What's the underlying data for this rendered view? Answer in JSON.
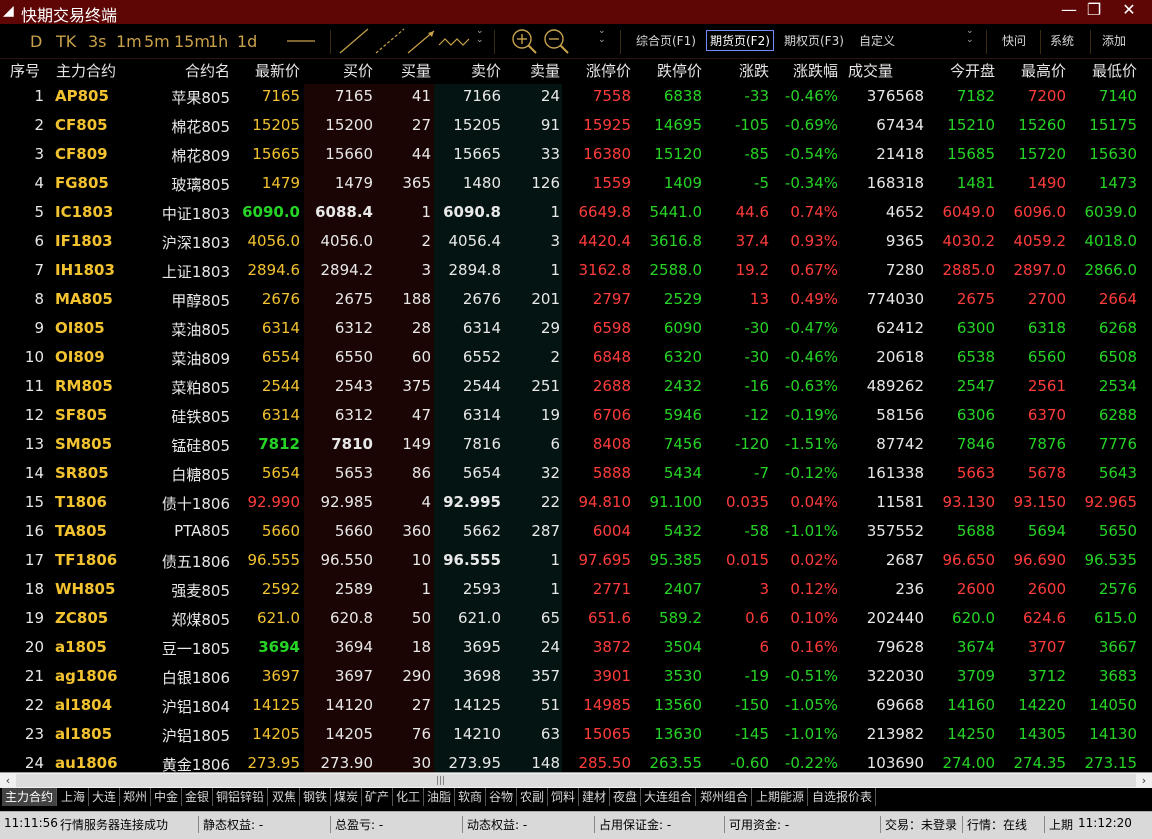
{
  "window": {
    "title": "快期交易终端",
    "minimize_glyph": "—",
    "maximize_glyph": "❐",
    "close_glyph": "✕"
  },
  "toolbar": {
    "timeframes": [
      "D",
      "TK",
      "3s",
      "1m",
      "5m",
      "15m",
      "1h",
      "1d"
    ],
    "buttons": [
      "综合页(F1)",
      "期货页(F2)",
      "期权页(F3)",
      "自定义"
    ],
    "active_button": "期货页(F2)",
    "right_buttons": [
      "快问",
      "系统",
      "添加"
    ]
  },
  "columns": [
    "序号",
    "主力合约",
    "合约名",
    "最新价",
    "买价",
    "买量",
    "卖价",
    "卖量",
    "涨停价",
    "跌停价",
    "涨跌",
    "涨跌幅",
    "成交量",
    "今开盘",
    "最高价",
    "最低价"
  ],
  "rows": [
    [
      "1",
      "AP805",
      "苹果805",
      "7165",
      "7165",
      "41",
      "7166",
      "24",
      "7558",
      "6838",
      "-33",
      "-0.46%",
      "376568",
      "7182",
      "7200",
      "7140"
    ],
    [
      "2",
      "CF805",
      "棉花805",
      "15205",
      "15200",
      "27",
      "15205",
      "91",
      "15925",
      "14695",
      "-105",
      "-0.69%",
      "67434",
      "15210",
      "15260",
      "15175"
    ],
    [
      "3",
      "CF809",
      "棉花809",
      "15665",
      "15660",
      "44",
      "15665",
      "33",
      "16380",
      "15120",
      "-85",
      "-0.54%",
      "21418",
      "15685",
      "15720",
      "15630"
    ],
    [
      "4",
      "FG805",
      "玻璃805",
      "1479",
      "1479",
      "365",
      "1480",
      "126",
      "1559",
      "1409",
      "-5",
      "-0.34%",
      "168318",
      "1481",
      "1490",
      "1473"
    ],
    [
      "5",
      "IC1803",
      "中证1803",
      "6090.0",
      "6088.4",
      "1",
      "6090.8",
      "1",
      "6649.8",
      "5441.0",
      "44.6",
      "0.74%",
      "4652",
      "6049.0",
      "6096.0",
      "6039.0"
    ],
    [
      "6",
      "IF1803",
      "沪深1803",
      "4056.0",
      "4056.0",
      "2",
      "4056.4",
      "3",
      "4420.4",
      "3616.8",
      "37.4",
      "0.93%",
      "9365",
      "4030.2",
      "4059.2",
      "4018.0"
    ],
    [
      "7",
      "IH1803",
      "上证1803",
      "2894.6",
      "2894.2",
      "3",
      "2894.8",
      "1",
      "3162.8",
      "2588.0",
      "19.2",
      "0.67%",
      "7280",
      "2885.0",
      "2897.0",
      "2866.0"
    ],
    [
      "8",
      "MA805",
      "甲醇805",
      "2676",
      "2675",
      "188",
      "2676",
      "201",
      "2797",
      "2529",
      "13",
      "0.49%",
      "774030",
      "2675",
      "2700",
      "2664"
    ],
    [
      "9",
      "OI805",
      "菜油805",
      "6314",
      "6312",
      "28",
      "6314",
      "29",
      "6598",
      "6090",
      "-30",
      "-0.47%",
      "62412",
      "6300",
      "6318",
      "6268"
    ],
    [
      "10",
      "OI809",
      "菜油809",
      "6554",
      "6550",
      "60",
      "6552",
      "2",
      "6848",
      "6320",
      "-30",
      "-0.46%",
      "20618",
      "6538",
      "6560",
      "6508"
    ],
    [
      "11",
      "RM805",
      "菜粕805",
      "2544",
      "2543",
      "375",
      "2544",
      "251",
      "2688",
      "2432",
      "-16",
      "-0.63%",
      "489262",
      "2547",
      "2561",
      "2534"
    ],
    [
      "12",
      "SF805",
      "硅铁805",
      "6314",
      "6312",
      "47",
      "6314",
      "19",
      "6706",
      "5946",
      "-12",
      "-0.19%",
      "58156",
      "6306",
      "6370",
      "6288"
    ],
    [
      "13",
      "SM805",
      "锰硅805",
      "7812",
      "7810",
      "149",
      "7816",
      "6",
      "8408",
      "7456",
      "-120",
      "-1.51%",
      "87742",
      "7846",
      "7876",
      "7776"
    ],
    [
      "14",
      "SR805",
      "白糖805",
      "5654",
      "5653",
      "86",
      "5654",
      "32",
      "5888",
      "5434",
      "-7",
      "-0.12%",
      "161338",
      "5663",
      "5678",
      "5643"
    ],
    [
      "15",
      "T1806",
      "债十1806",
      "92.990",
      "92.985",
      "4",
      "92.995",
      "22",
      "94.810",
      "91.100",
      "0.035",
      "0.04%",
      "11581",
      "93.130",
      "93.150",
      "92.965"
    ],
    [
      "16",
      "TA805",
      "PTA805",
      "5660",
      "5660",
      "360",
      "5662",
      "287",
      "6004",
      "5432",
      "-58",
      "-1.01%",
      "357552",
      "5688",
      "5694",
      "5650"
    ],
    [
      "17",
      "TF1806",
      "债五1806",
      "96.555",
      "96.550",
      "10",
      "96.555",
      "1",
      "97.695",
      "95.385",
      "0.015",
      "0.02%",
      "2687",
      "96.650",
      "96.690",
      "96.535"
    ],
    [
      "18",
      "WH805",
      "强麦805",
      "2592",
      "2589",
      "1",
      "2593",
      "1",
      "2771",
      "2407",
      "3",
      "0.12%",
      "236",
      "2600",
      "2600",
      "2576"
    ],
    [
      "19",
      "ZC805",
      "郑煤805",
      "621.0",
      "620.8",
      "50",
      "621.0",
      "65",
      "651.6",
      "589.2",
      "0.6",
      "0.10%",
      "202440",
      "620.0",
      "624.6",
      "615.0"
    ],
    [
      "20",
      "a1805",
      "豆一1805",
      "3694",
      "3694",
      "18",
      "3695",
      "24",
      "3872",
      "3504",
      "6",
      "0.16%",
      "79628",
      "3674",
      "3707",
      "3667"
    ],
    [
      "21",
      "ag1806",
      "白银1806",
      "3697",
      "3697",
      "290",
      "3698",
      "357",
      "3901",
      "3530",
      "-19",
      "-0.51%",
      "322030",
      "3709",
      "3712",
      "3683"
    ],
    [
      "22",
      "al1804",
      "沪铝1804",
      "14125",
      "14120",
      "27",
      "14125",
      "51",
      "14985",
      "13560",
      "-150",
      "-1.05%",
      "69668",
      "14160",
      "14220",
      "14050"
    ],
    [
      "23",
      "al1805",
      "沪铝1805",
      "14205",
      "14205",
      "76",
      "14210",
      "63",
      "15065",
      "13630",
      "-145",
      "-1.01%",
      "213982",
      "14250",
      "14305",
      "14130"
    ],
    [
      "24",
      "au1806",
      "黄金1806",
      "273.95",
      "273.90",
      "30",
      "273.95",
      "148",
      "285.50",
      "263.55",
      "-0.60",
      "-0.22%",
      "103690",
      "274.00",
      "274.35",
      "273.15"
    ]
  ],
  "tabs": [
    "主力合约",
    "上海",
    "大连",
    "郑州",
    "中金",
    "金银",
    "铜铝锌铅",
    "双焦",
    "钢铁",
    "煤炭",
    "矿产",
    "化工",
    "油脂",
    "软商",
    "谷物",
    "农副",
    "饲料",
    "建材",
    "夜盘",
    "大连组合",
    "郑州组合",
    "上期能源",
    "自选报价表"
  ],
  "active_tab": "主力合约",
  "status": {
    "time_left": "11:11:56",
    "message": "行情服务器连接成功",
    "static_equity": "静态权益: -",
    "total_pnl": "总盈亏: -",
    "dynamic_equity": "动态权益: -",
    "margin": "占用保证金: -",
    "available": "可用资金: -",
    "trade": "交易：未登录",
    "quote": "行情：在线",
    "market": "上期",
    "time_right": "11:12:20"
  },
  "colors": {
    "up": "#ff3c3c",
    "down": "#26d426",
    "flat": "#e8e8e8",
    "contract": "#f2c230",
    "title_bg": "#5e0505"
  }
}
